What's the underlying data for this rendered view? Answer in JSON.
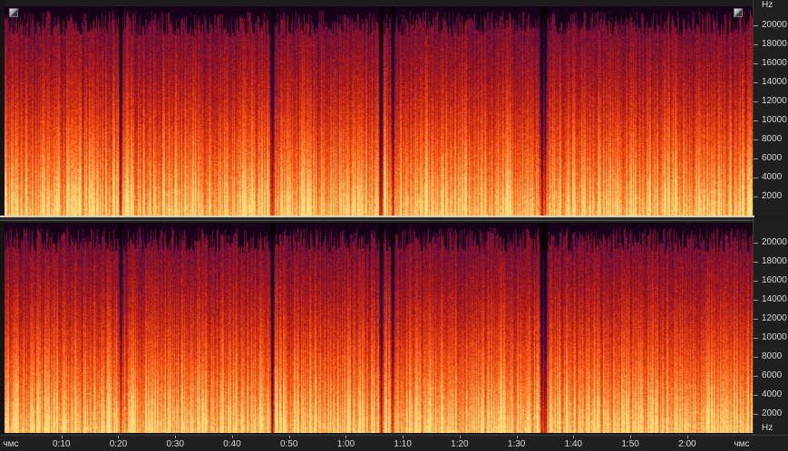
{
  "view": {
    "type": "spectral-frequency-display",
    "channels": 2,
    "colors": {
      "background": "#0a0008",
      "low": "#3a0a4a",
      "mid": "#b01818",
      "high": "#ff5a10",
      "peak": "#ffe080"
    }
  },
  "frequency_ruler": {
    "unit": "Hz",
    "labels": [
      "20000",
      "18000",
      "16000",
      "14000",
      "12000",
      "10000",
      "8000",
      "6000",
      "4000",
      "2000"
    ],
    "values": [
      20000,
      18000,
      16000,
      14000,
      12000,
      10000,
      8000,
      6000,
      4000,
      2000
    ],
    "max_hz": 22050
  },
  "time_ruler": {
    "unit_label": "чмс",
    "labels": [
      "0:10",
      "0:20",
      "0:30",
      "0:40",
      "0:50",
      "1:00",
      "1:10",
      "1:20",
      "1:30",
      "1:40",
      "1:50",
      "2:00"
    ],
    "seconds": [
      10,
      20,
      30,
      40,
      50,
      60,
      70,
      80,
      90,
      100,
      110,
      120
    ],
    "start_seconds": 0,
    "end_seconds": 131.5
  },
  "buttons": {
    "zoom_left": "zoom-corner",
    "zoom_right": "zoom-corner"
  }
}
